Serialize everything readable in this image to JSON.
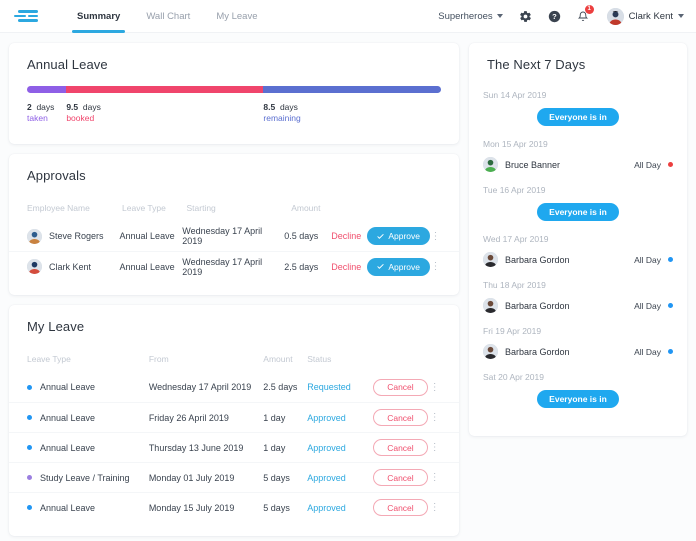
{
  "header": {
    "logo_name": "timetastic-logo",
    "tabs": [
      {
        "label": "Summary",
        "active": true
      },
      {
        "label": "Wall Chart",
        "active": false
      },
      {
        "label": "My Leave",
        "active": false
      }
    ],
    "team_selector": "Superheroes",
    "icons": [
      "gear-icon",
      "help-icon",
      "bell-icon"
    ],
    "notification_count": "1",
    "user_name": "Clark Kent"
  },
  "annual_leave": {
    "title": "Annual Leave",
    "segments": [
      {
        "key": "taken",
        "value": "2",
        "unit": "days",
        "color": "#8e5fe6",
        "pct": 9.5
      },
      {
        "key": "booked",
        "value": "9.5",
        "unit": "days",
        "color": "#f0456c",
        "pct": 47.6
      },
      {
        "key": "remaining",
        "value": "8.5",
        "unit": "days",
        "color": "#5b6fd0",
        "pct": 42.9
      }
    ],
    "label_colors": {
      "taken": "#8e5fe6",
      "booked": "#f0456c",
      "remaining": "#5b6fd0"
    }
  },
  "approvals": {
    "title": "Approvals",
    "columns": [
      "Employee Name",
      "Leave Type",
      "Starting",
      "Amount"
    ],
    "decline_label": "Decline",
    "approve_label": "Approve",
    "rows": [
      {
        "name": "Steve Rogers",
        "leave_type": "Annual Leave",
        "starting": "Wednesday 17 April 2019",
        "amount": "0.5 days",
        "avatar_colors": [
          "#2e5d8e",
          "#c9823f"
        ]
      },
      {
        "name": "Clark Kent",
        "leave_type": "Annual Leave",
        "starting": "Wednesday 17 April 2019",
        "amount": "2.5 days",
        "avatar_colors": [
          "#1f3a63",
          "#d44c3c"
        ]
      }
    ]
  },
  "my_leave": {
    "title": "My Leave",
    "columns": [
      "Leave Type",
      "From",
      "Amount",
      "Status"
    ],
    "cancel_label": "Cancel",
    "rows": [
      {
        "leave_type": "Annual Leave",
        "from": "Wednesday 17 April 2019",
        "amount": "2.5 days",
        "status": "Requested",
        "dot": "#2196f3",
        "status_color": "#2ca8e0"
      },
      {
        "leave_type": "Annual Leave",
        "from": "Friday 26 April 2019",
        "amount": "1 day",
        "status": "Approved",
        "dot": "#2196f3",
        "status_color": "#2ca8e0"
      },
      {
        "leave_type": "Annual Leave",
        "from": "Thursday 13 June 2019",
        "amount": "1 day",
        "status": "Approved",
        "dot": "#2196f3",
        "status_color": "#2ca8e0"
      },
      {
        "leave_type": "Study Leave / Training",
        "from": "Monday 01 July 2019",
        "amount": "5 days",
        "status": "Approved",
        "dot": "#9b7fe0",
        "status_color": "#2ca8e0"
      },
      {
        "leave_type": "Annual Leave",
        "from": "Monday 15 July 2019",
        "amount": "5 days",
        "status": "Approved",
        "dot": "#2196f3",
        "status_color": "#2ca8e0"
      }
    ]
  },
  "next_7_days": {
    "title": "The Next 7 Days",
    "everyone_label": "Everyone is in",
    "all_day_label": "All Day",
    "days": [
      {
        "date": "Sun 14 Apr 2019",
        "everyone_in": true,
        "person": null,
        "dot": null,
        "avatar_colors": null
      },
      {
        "date": "Mon 15 Apr 2019",
        "everyone_in": false,
        "person": "Bruce Banner",
        "dot": "#ec3f3f",
        "avatar_colors": [
          "#2d6b3f",
          "#4caf50"
        ]
      },
      {
        "date": "Tue 16 Apr 2019",
        "everyone_in": true,
        "person": null,
        "dot": null,
        "avatar_colors": null
      },
      {
        "date": "Wed 17 Apr 2019",
        "everyone_in": false,
        "person": "Barbara Gordon",
        "dot": "#2196f3",
        "avatar_colors": [
          "#6b4a3a",
          "#2a2a2e"
        ]
      },
      {
        "date": "Thu 18 Apr 2019",
        "everyone_in": false,
        "person": "Barbara Gordon",
        "dot": "#2196f3",
        "avatar_colors": [
          "#6b4a3a",
          "#2a2a2e"
        ]
      },
      {
        "date": "Fri 19 Apr 2019",
        "everyone_in": false,
        "person": "Barbara Gordon",
        "dot": "#2196f3",
        "avatar_colors": [
          "#6b4a3a",
          "#2a2a2e"
        ]
      },
      {
        "date": "Sat 20 Apr 2019",
        "everyone_in": true,
        "person": null,
        "dot": null,
        "avatar_colors": null
      }
    ]
  }
}
